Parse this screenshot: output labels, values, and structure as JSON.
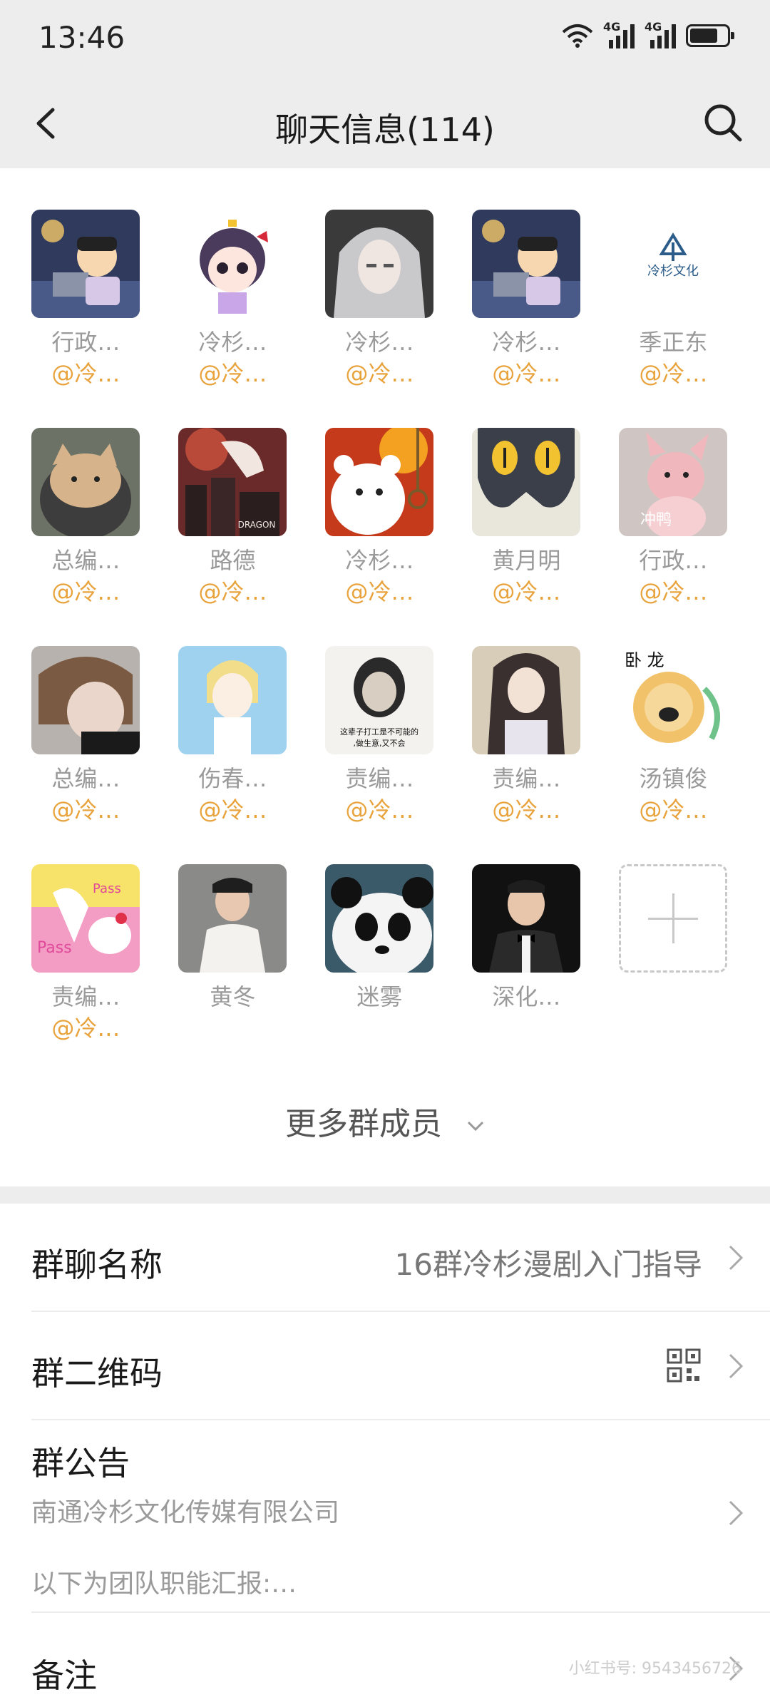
{
  "status": {
    "time": "13:46",
    "network1": "4G",
    "network2": "4G",
    "battery_level": 0.75
  },
  "nav": {
    "title": "聊天信息(114)"
  },
  "members": [
    {
      "name": "行政…",
      "role": "@冷…",
      "avatar": "crayon-laptop"
    },
    {
      "name": "冷杉…",
      "role": "@冷…",
      "avatar": "anime-girl"
    },
    {
      "name": "冷杉…",
      "role": "@冷…",
      "avatar": "silver-hair"
    },
    {
      "name": "冷杉…",
      "role": "@冷…",
      "avatar": "crayon-laptop"
    },
    {
      "name": "季正东",
      "role": "@冷…",
      "avatar": "lengshan-logo",
      "logo_text": "冷杉文化"
    },
    {
      "name": "总编…",
      "role": "@冷…",
      "avatar": "cat"
    },
    {
      "name": "路德",
      "role": "@冷…",
      "avatar": "dragon-city",
      "caption": "DRAGON"
    },
    {
      "name": "冷杉…",
      "role": "@冷…",
      "avatar": "bear-fire"
    },
    {
      "name": "黄月明",
      "role": "@冷…",
      "avatar": "black-cat"
    },
    {
      "name": "行政…",
      "role": "@冷…",
      "avatar": "pink-fox",
      "overlay": "冲鸭"
    },
    {
      "name": "总编…",
      "role": "@冷…",
      "avatar": "brown-hair"
    },
    {
      "name": "伤春…",
      "role": "@冷…",
      "avatar": "blonde-boy"
    },
    {
      "name": "责编…",
      "role": "@冷…",
      "avatar": "meme-sketch",
      "caption": "这辈子打工是不可能的,做生意,又不会"
    },
    {
      "name": "责编…",
      "role": "@冷…",
      "avatar": "ancient-hero"
    },
    {
      "name": "汤镇俊",
      "role": "@冷…",
      "avatar": "lion-dog",
      "overlay": "卧 龙"
    },
    {
      "name": "责编…",
      "role": "@冷…",
      "avatar": "hello-kitty",
      "caption": "Pass"
    },
    {
      "name": "黄冬",
      "role": "",
      "avatar": "man-white-suit"
    },
    {
      "name": "迷雾",
      "role": "",
      "avatar": "panda"
    },
    {
      "name": "深化…",
      "role": "",
      "avatar": "man-bow-tie"
    }
  ],
  "more_members": "更多群成员",
  "group_name": {
    "label": "群聊名称",
    "value": "16群冷杉漫剧入门指导"
  },
  "qr": {
    "label": "群二维码"
  },
  "notice": {
    "label": "群公告",
    "line1": "南通冷杉文化传媒有限公司",
    "line2": "以下为团队职能汇报:…"
  },
  "remark": {
    "label": "备注"
  },
  "watermark": "小红书号: 9543456726",
  "colors": {
    "header_bg": "#ededed",
    "role_color": "#e8a33c",
    "name_color": "#9a9a9a"
  }
}
